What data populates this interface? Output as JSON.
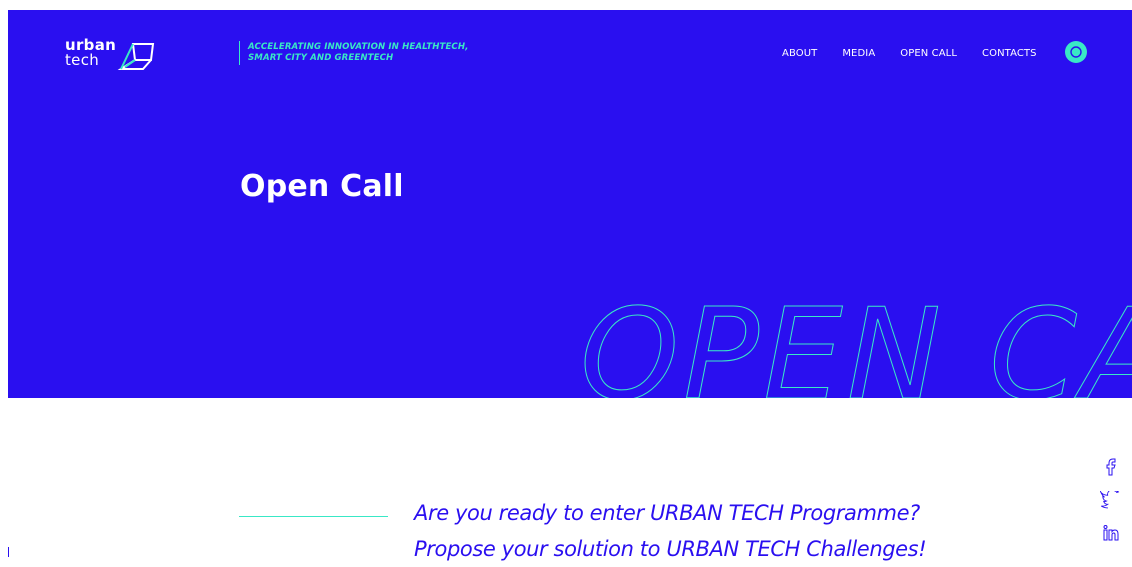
{
  "brand": {
    "logo_line1": "urban",
    "logo_line2": "tech"
  },
  "header": {
    "tagline_line1": "ACCELERATING INNOVATION IN HEALTHTECH,",
    "tagline_line2": "SMART CITY AND GREENTECH"
  },
  "nav": {
    "items": [
      {
        "label": "ABOUT"
      },
      {
        "label": "MEDIA"
      },
      {
        "label": "OPEN CALL"
      },
      {
        "label": "CONTACTS"
      }
    ],
    "search_icon": "search-icon"
  },
  "hero": {
    "title": "Open Call",
    "background_text": "OPEN CALL"
  },
  "content": {
    "intro_line1": "Are you ready to enter URBAN TECH Programme?",
    "intro_line2": "Propose your solution to URBAN TECH Challenges!"
  },
  "social": {
    "items": [
      {
        "icon": "facebook-icon"
      },
      {
        "icon": "twitter-icon"
      },
      {
        "icon": "linkedin-icon"
      }
    ]
  },
  "colors": {
    "brand_blue": "#2a0ff0",
    "accent_teal": "#39e8c6",
    "white": "#ffffff"
  }
}
